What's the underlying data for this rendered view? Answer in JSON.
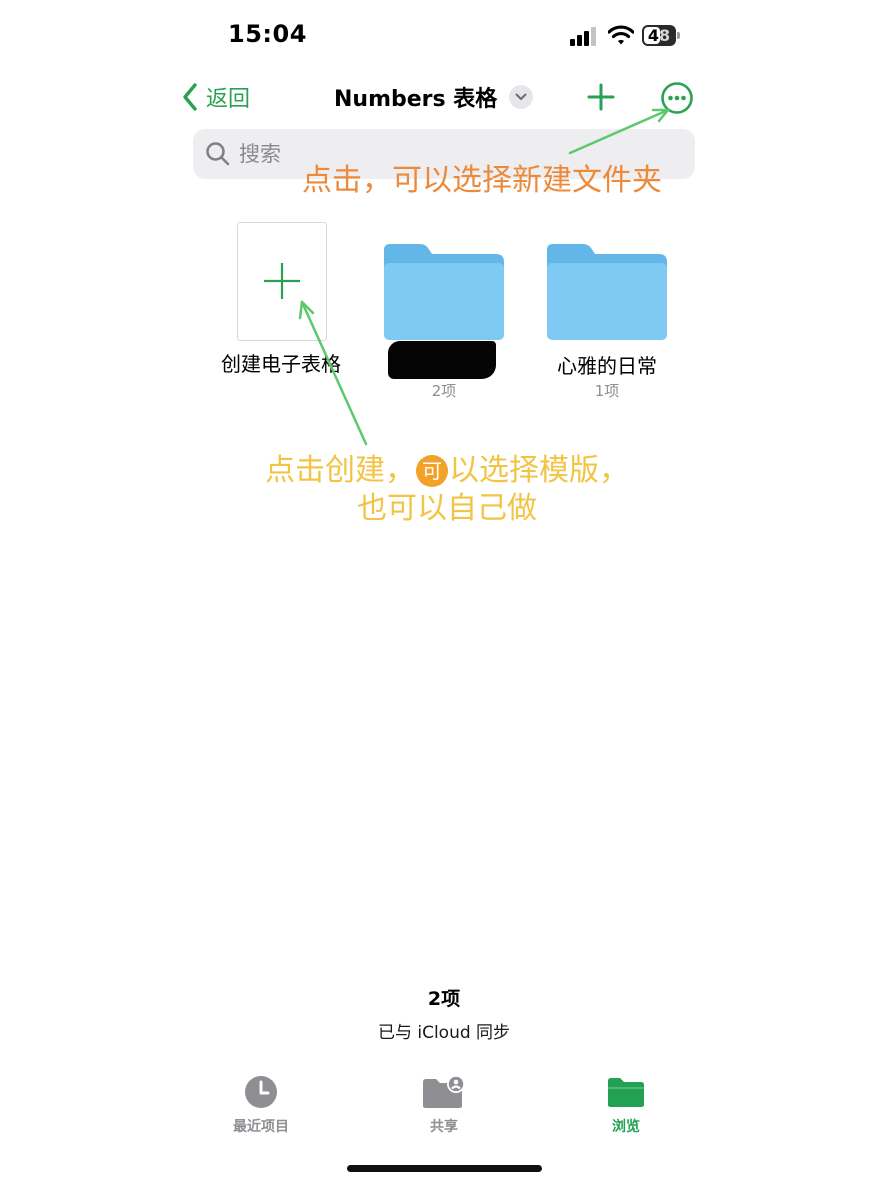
{
  "status_bar": {
    "time": "15:04",
    "battery": "48"
  },
  "nav": {
    "back_label": "返回",
    "title": "Numbers 表格"
  },
  "search": {
    "placeholder": "搜索"
  },
  "annotations": {
    "top": "点击，可以选择新建文件夹",
    "middle_part1": "点击创建，",
    "middle_badge": "可",
    "middle_part2": "以选择模版，也可以自己做"
  },
  "items": [
    {
      "label": "创建电子表格"
    },
    {
      "label": "",
      "count": "2项"
    },
    {
      "label": "心雅的日常",
      "count": "1项"
    }
  ],
  "footer": {
    "count": "2项",
    "sync": "已与 iCloud 同步"
  },
  "tabs": [
    {
      "label": "最近项目",
      "icon": "clock-icon"
    },
    {
      "label": "共享",
      "icon": "shared-folder-icon"
    },
    {
      "label": "浏览",
      "icon": "folder-icon",
      "active": true
    }
  ],
  "colors": {
    "accent": "#2aa152",
    "folder": "#7cc8f2",
    "annotation_orange": "#ec8a3c",
    "annotation_yellow": "#f2c443"
  }
}
